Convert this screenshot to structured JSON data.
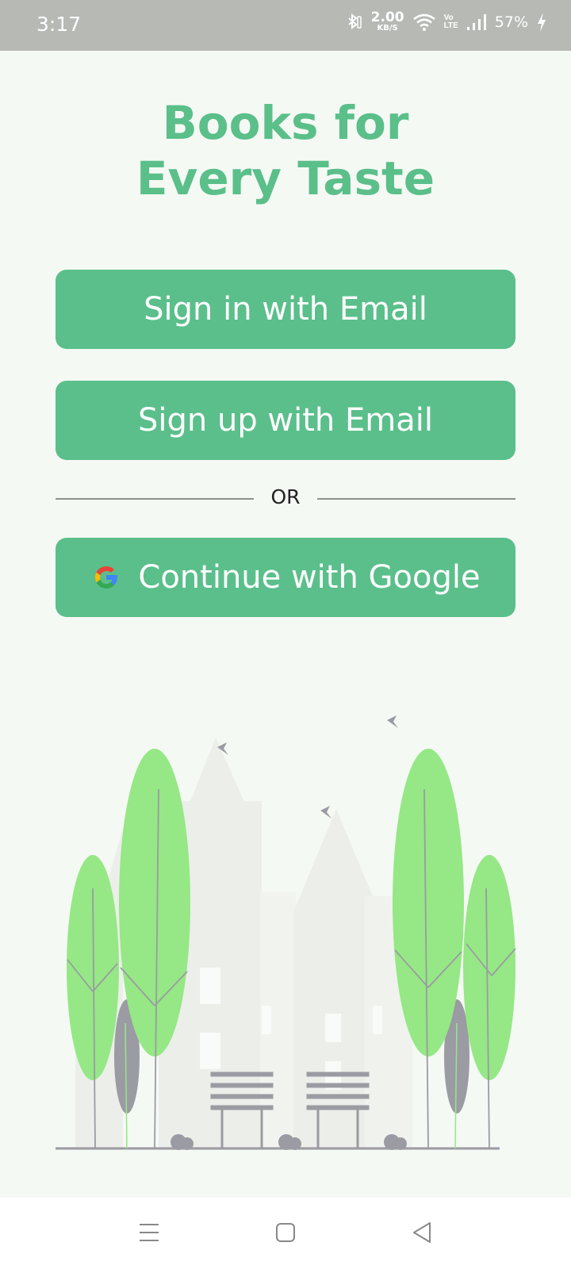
{
  "status_bar": {
    "time": "3:17",
    "net_speed_value": "2.00",
    "net_speed_unit": "KB/S",
    "volte_top": "Vo",
    "volte_bottom": "LTE",
    "battery": "57%",
    "icons": [
      "bluetooth-icon",
      "wifi-icon",
      "signal-icon",
      "charging-icon"
    ]
  },
  "title": {
    "line1": "Books for",
    "line2": "Every Taste"
  },
  "buttons": {
    "sign_in": "Sign in with Email",
    "sign_up": "Sign up with Email",
    "or": "OR",
    "google": "Continue with Google"
  },
  "illustration": {
    "description_icon": "park-city-illustration",
    "tree_color": "#95e885",
    "building_color": "#eceeea",
    "bench_color": "#9b9ba3"
  },
  "nav_bar": {
    "icons": [
      "menu-icon",
      "home-icon",
      "back-icon"
    ]
  },
  "colors": {
    "accent": "#5bbf8b",
    "background": "#f5f9f4",
    "status_bar": "#b6b9b4"
  }
}
